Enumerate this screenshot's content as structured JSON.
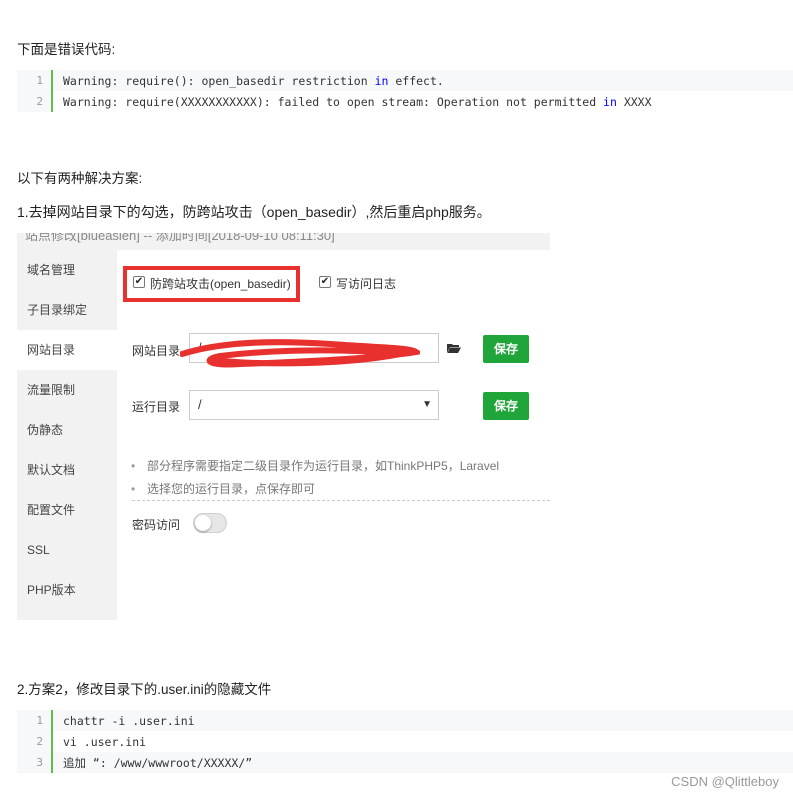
{
  "intro_text": "下面是错误代码:",
  "error_code": {
    "lines": [
      {
        "num": "1",
        "pre": "Warning: require(): open_basedir restriction ",
        "kw": "in",
        "post": " effect."
      },
      {
        "num": "2",
        "pre": "Warning: require(XXXXXXXXXXX): failed to open stream: Operation not permitted ",
        "kw": "in",
        "post": " XXXX"
      }
    ]
  },
  "solutions_heading": "以下有两种解决方案:",
  "solution1_text": "1.去掉网站目录下的勾选，防跨站攻击（open_basedir）,然后重启php服务。",
  "panel": {
    "top_title_cropped": "站点修改[blueasien] -- 添加时间[2018-09-10 08:11:30]",
    "sidebar": [
      "域名管理",
      "子目录绑定",
      "网站目录",
      "流量限制",
      "伪静态",
      "默认文档",
      "配置文件",
      "SSL",
      "PHP版本"
    ],
    "active_sidebar_index": 2,
    "checkbox_anticsrf_label": "防跨站攻击(open_basedir)",
    "checkbox_log_label": "写访问日志",
    "site_dir_label": "网站目录",
    "site_dir_value": "/",
    "save_label": "保存",
    "run_dir_label": "运行目录",
    "run_dir_value": "/",
    "tips": [
      "部分程序需要指定二级目录作为运行目录，如ThinkPHP5，Laravel",
      "选择您的运行目录，点保存即可"
    ],
    "password_access_label": "密码访问",
    "highlight_color": "#e8302f",
    "save_button_color": "#20a53a"
  },
  "solution2_text": "2.方案2，修改目录下的.user.ini的隐藏文件",
  "fix_code": {
    "lines": [
      {
        "num": "1",
        "text": "chattr -i .user.ini"
      },
      {
        "num": "2",
        "text": "vi .user.ini"
      },
      {
        "num": "3",
        "text": "追加 “: /www/wwwroot/XXXXX/”"
      }
    ]
  },
  "watermark": "CSDN @Qlittleboy"
}
